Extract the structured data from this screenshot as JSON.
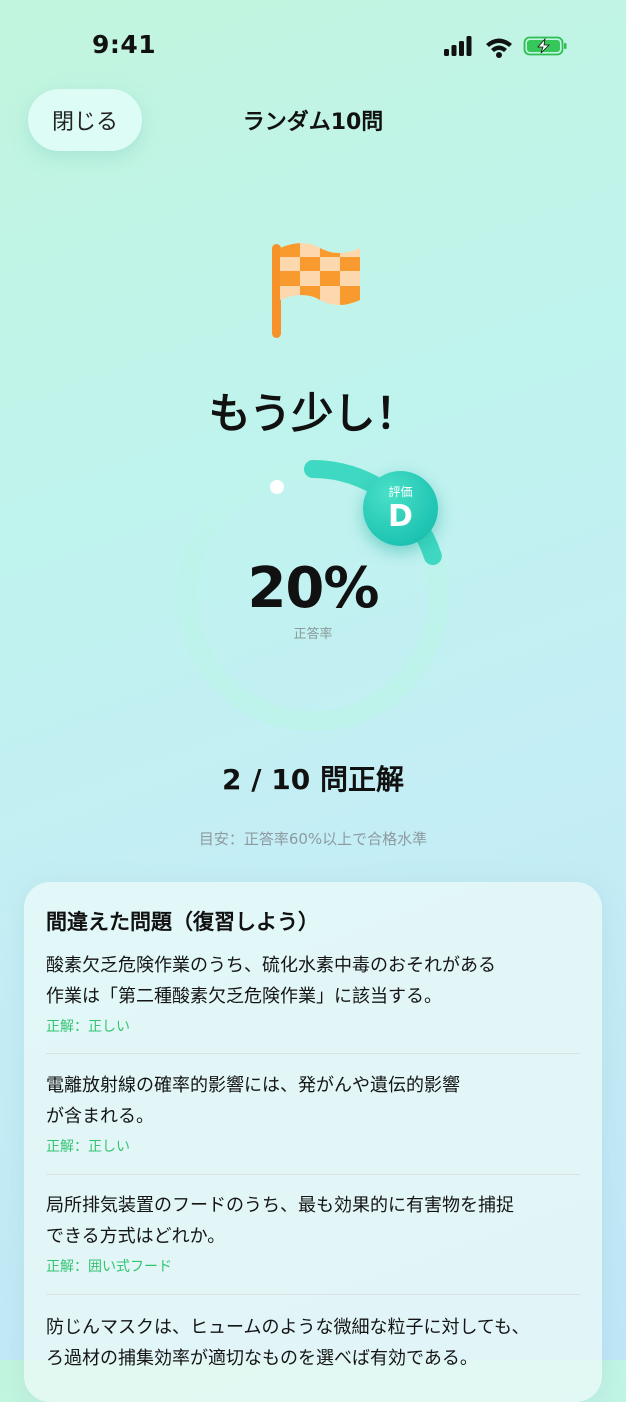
{
  "status_bar": {
    "time": "9:41"
  },
  "nav": {
    "close_label": "閉じる",
    "title": "ランダム10問"
  },
  "result": {
    "headline": "もう少し！",
    "percent": "20%",
    "percent_label": "正答率",
    "progress_fraction": 0.2,
    "grade_label": "評価",
    "grade": "D",
    "score": "2 / 10 問正解",
    "guide": "目安：正答率60%以上で合格水準"
  },
  "review": {
    "title": "間違えた問題（復習しよう）",
    "items": [
      {
        "question_line1": "酸素欠乏危険作業のうち、硫化水素中毒のおそれがある",
        "question_line2": "作業は「第二種酸素欠乏危険作業」に該当する。",
        "answer": "正解：正しい"
      },
      {
        "question_line1": "電離放射線の確率的影響には、発がんや遺伝的影響",
        "question_line2": "が含まれる。",
        "answer": "正解：正しい"
      },
      {
        "question_line1": "局所排気装置のフードのうち、最も効果的に有害物を捕捉",
        "question_line2": "できる方式はどれか。",
        "answer": "正解：囲い式フード"
      },
      {
        "question_line1": "防じんマスクは、ヒュームのような微細な粒子に対しても、",
        "question_line2": "ろ過材の捕集効率が適切なものを選べば有効である。",
        "answer": ""
      }
    ]
  },
  "colors": {
    "ring_track": "#b9f2ea",
    "ring_progress": "#3fd8c2",
    "badge": "#1fc4b3",
    "answer_text": "#33c46f",
    "flag_orange": "#f99a2e"
  },
  "icons": [
    "cellular-signal-icon",
    "wifi-icon",
    "battery-charging-icon",
    "checkered-flag-icon"
  ]
}
